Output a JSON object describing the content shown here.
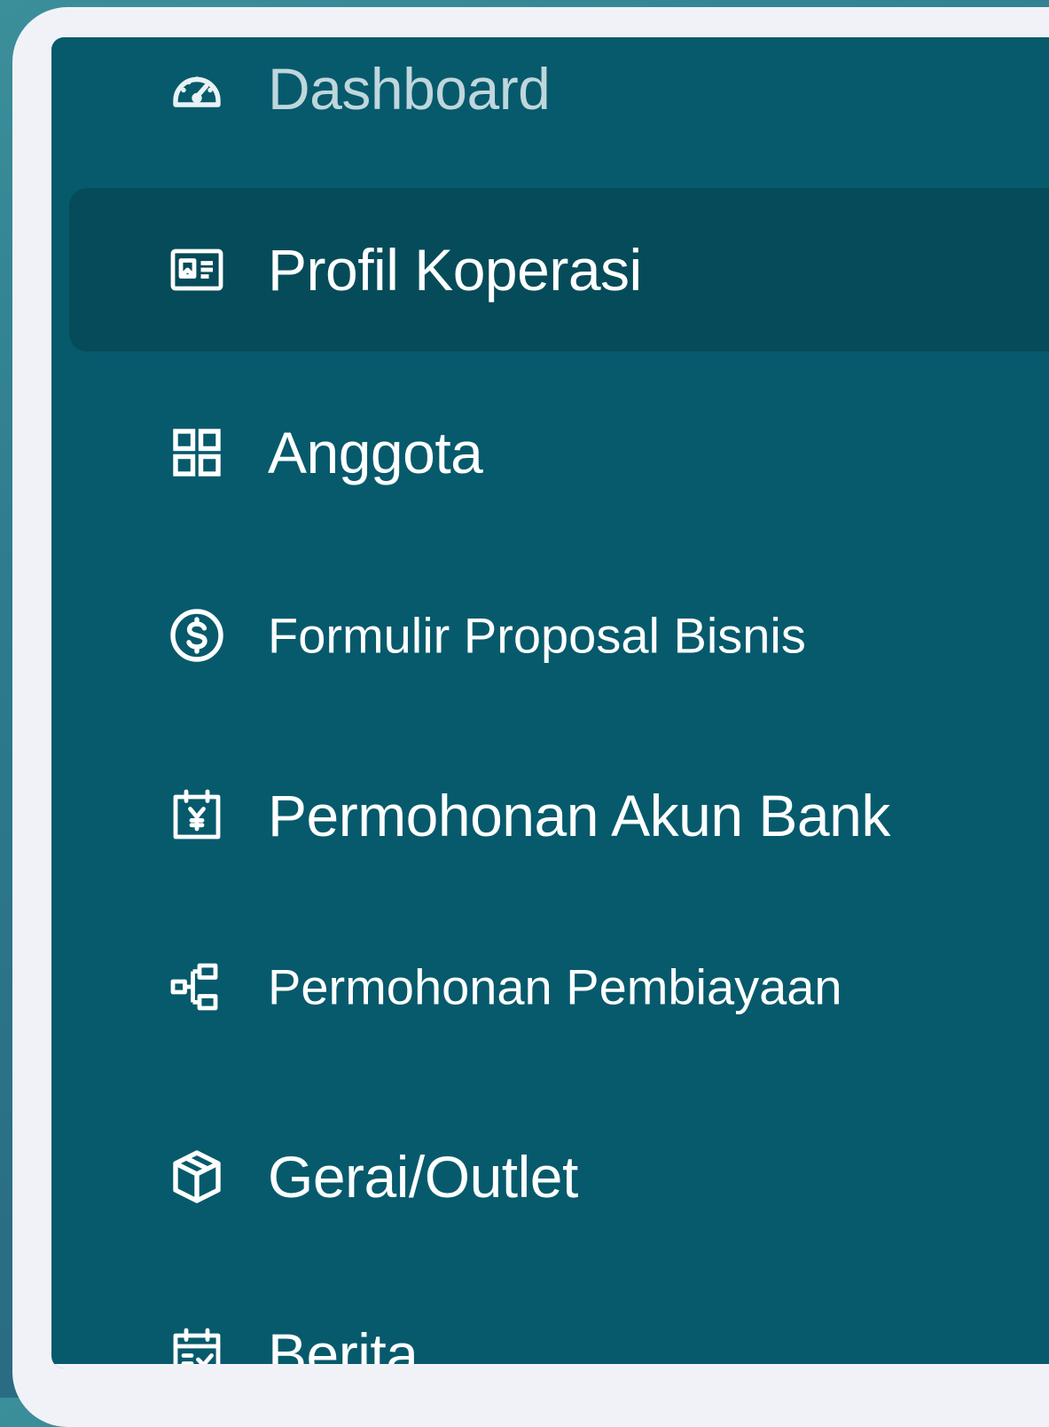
{
  "sidebar": {
    "items": [
      {
        "label": "Dashboard",
        "icon": "speedometer-icon",
        "state": "inactive"
      },
      {
        "label": "Profil Koperasi",
        "icon": "id-card-icon",
        "state": "active"
      },
      {
        "label": "Anggota",
        "icon": "grid-icon",
        "state": "inactive"
      },
      {
        "label": "Formulir Proposal Bisnis",
        "icon": "dollar-circle-icon",
        "state": "inactive"
      },
      {
        "label": "Permohonan Akun Bank",
        "icon": "calendar-yen-icon",
        "state": "inactive"
      },
      {
        "label": "Permohonan Pembiayaan",
        "icon": "hierarchy-icon",
        "state": "inactive"
      },
      {
        "label": "Gerai/Outlet",
        "icon": "cube-icon",
        "state": "inactive"
      },
      {
        "label": "Berita",
        "icon": "calendar-check-icon",
        "state": "inactive"
      }
    ]
  },
  "colors": {
    "panel_background": "#065a6c",
    "active_item_background": "#064b59",
    "frame_background": "#f1f2f7",
    "text": "#ffffff",
    "muted_text": "#bfd6dc"
  }
}
